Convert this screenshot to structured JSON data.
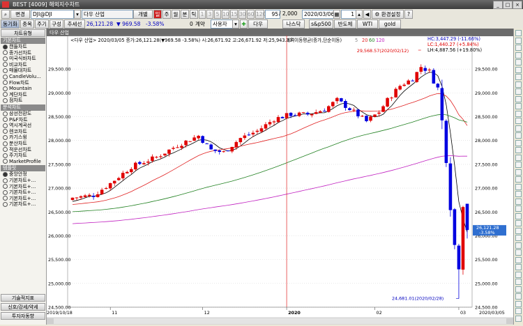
{
  "window": {
    "brand": "BEST",
    "title": "[4009] 해외지수차트"
  },
  "toolbar1": {
    "change": "변경",
    "symbol": "DJI@DJI",
    "name": "다우 산업",
    "individual": "개별",
    "periods": [
      "주",
      "월",
      "분",
      "틱"
    ],
    "small_nums": [
      "1",
      "3",
      "5",
      "10",
      "15",
      "30",
      "60",
      "120"
    ],
    "count": "95",
    "total": "/ 2,000",
    "date": "2020/03/06",
    "step": "1",
    "settings": "환경설정"
  },
  "toolbar2": {
    "buttons": [
      "동기화",
      "종목",
      "주기",
      "구성",
      "추세선"
    ],
    "price": "26,121.28",
    "change": "▼ 969.58",
    "pct": "-3.58%",
    "volume": "0",
    "volume_unit": "계약",
    "user_label": "사용자",
    "indices": [
      "다우",
      "나스닥",
      "s&p500",
      "반도체",
      "WTI",
      "gold"
    ]
  },
  "sidebar": {
    "title": "차트유형",
    "groups": [
      {
        "name": "기본차트",
        "items": [
          "캔들차트",
          "종가선차트",
          "미국식바차트",
          "비교차트",
          "매물대차트",
          "CandleVolu...",
          "Flow차트",
          "Mountain",
          "계단차트",
          "점차트"
        ]
      },
      {
        "name": "분석차트",
        "items": [
          "삼선전환도",
          "P&F차트",
          "역시계곡선",
          "렌코차트",
          "카기스윙",
          "분산차트",
          "적운선차트",
          "주기차트",
          "MarketProfile"
        ]
      },
      {
        "name": "템플릿",
        "items": [
          "중앙안정",
          "기본차트+...",
          "기본차트+...",
          "기본차트+...",
          "기본차트+...",
          "기본차트+..."
        ]
      }
    ],
    "bottom_buttons": [
      "기술적지표",
      "신호/강세/약세",
      "투자자동향"
    ]
  },
  "chart_data": {
    "type": "candlestick",
    "title": "다우 산업",
    "header_text": "2020/03/05 종가:26,121.28(▼969.58 -3.58%) 시:26,671.92 고:26,671.92 저:25,943.33",
    "ma_label": "가격이동평균(종가,단순이동)",
    "ma_periods": [
      "5",
      "20",
      "60",
      "120"
    ],
    "ma_colors": [
      "#000000",
      "#e02020",
      "#208020",
      "#c020c0"
    ],
    "up_color": "#e00000",
    "down_color": "#0000e0",
    "stats": {
      "hc": "HC:3,447.29 (-11.66%)",
      "lc": "LC:1,440.27 (+5.84%)",
      "lh": "LH:4,887.56 (+19.80%)"
    },
    "ylim": [
      24500,
      30000
    ],
    "y_ticks": [
      "29,500.00",
      "29,000.00",
      "28,500.00",
      "28,000.00",
      "27,500.00",
      "27,000.00",
      "26,500.00",
      "26,000.00",
      "25,500.00",
      "25,000.00",
      "24,500.00"
    ],
    "x_labels": [
      "2019/10/18",
      "11",
      "12",
      "2020",
      "02",
      "03",
      "2020/03/05"
    ],
    "last_price_box": [
      "26,121.28",
      "-3.58%"
    ],
    "high_annotation": "29,568.57(2020/02/12)",
    "low_annotation": "24,681.01(2020/02/28)"
  }
}
